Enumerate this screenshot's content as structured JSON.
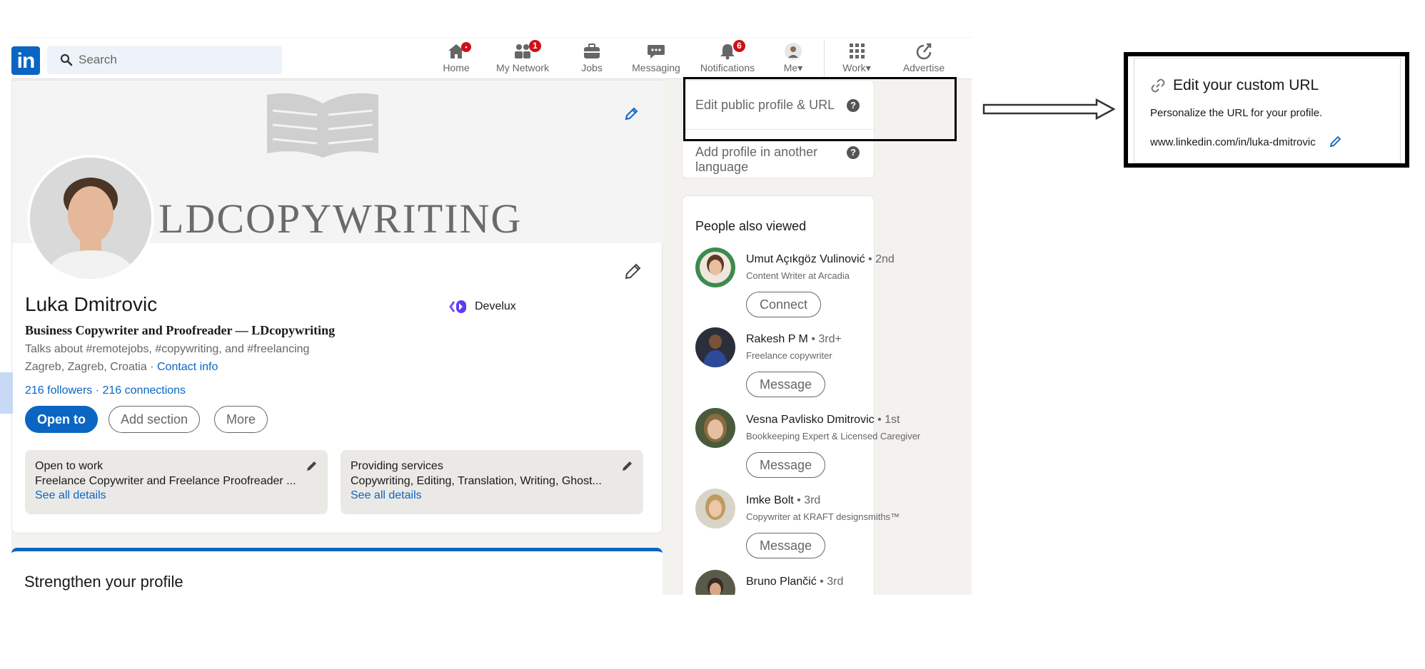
{
  "nav": {
    "logo": "in",
    "search_placeholder": "Search",
    "items": [
      {
        "label": "Home",
        "icon": "home-icon",
        "badge": "•"
      },
      {
        "label": "My Network",
        "icon": "network-icon",
        "badge": "1"
      },
      {
        "label": "Jobs",
        "icon": "briefcase-icon",
        "badge": ""
      },
      {
        "label": "Messaging",
        "icon": "messaging-icon",
        "badge": ""
      },
      {
        "label": "Notifications",
        "icon": "bell-icon",
        "badge": "6"
      },
      {
        "label": "Me",
        "icon": "avatar-icon",
        "badge": ""
      },
      {
        "label": "Work",
        "icon": "grid-icon",
        "badge": ""
      },
      {
        "label": "Advertise",
        "icon": "advertise-icon",
        "badge": ""
      }
    ]
  },
  "profile": {
    "banner_text": "LDCOPYWRITING",
    "name": "Luka Dmitrovic",
    "headline": "Business Copywriter and Proofreader — LDcopywriting",
    "talks": "Talks about #remotejobs, #copywriting, and #freelancing",
    "location": "Zagreb, Zagreb, Croatia ·",
    "contact": "Contact info",
    "followers": "216 followers",
    "connections": "· 216 connections",
    "company": "Develux",
    "buttons": {
      "open_to": "Open to",
      "add_section": "Add section",
      "more": "More"
    },
    "open_to_work": {
      "title": "Open to work",
      "desc": "Freelance Copywriter and Freelance Proofreader ...",
      "link": "See all details"
    },
    "services": {
      "title": "Providing services",
      "desc": "Copywriting, Editing, Translation, Writing, Ghost...",
      "link": "See all details"
    },
    "strengthen": "Strengthen your profile"
  },
  "sidebar": {
    "edit_public": "Edit public profile & URL",
    "add_language": "Add profile in another language",
    "help": "?",
    "people_title": "People also viewed",
    "people": [
      {
        "name": "Umut Açıkgöz Vulinović",
        "degree": "• 2nd",
        "title": "Content Writer at Arcadia",
        "action": "Connect"
      },
      {
        "name": "Rakesh P M",
        "degree": "• 3rd+",
        "title": "Freelance copywriter",
        "action": "Message"
      },
      {
        "name": "Vesna Pavlisko Dmitrovic",
        "degree": "• 1st",
        "title": "Bookkeeping Expert & Licensed Caregiver",
        "action": "Message"
      },
      {
        "name": "Imke Bolt",
        "degree": "• 3rd",
        "title": "Copywriter at KRAFT designsmiths™",
        "action": "Message"
      },
      {
        "name": "Bruno Plančić",
        "degree": "• 3rd",
        "title": "",
        "action": ""
      }
    ]
  },
  "callout": {
    "title": "Edit your custom URL",
    "desc": "Personalize the URL for your profile.",
    "url": "www.linkedin.com/in/luka-dmitrovic"
  },
  "colors": {
    "brand": "#0a66c2",
    "badge": "#cc1016",
    "page_bg": "#f3f2ef"
  }
}
